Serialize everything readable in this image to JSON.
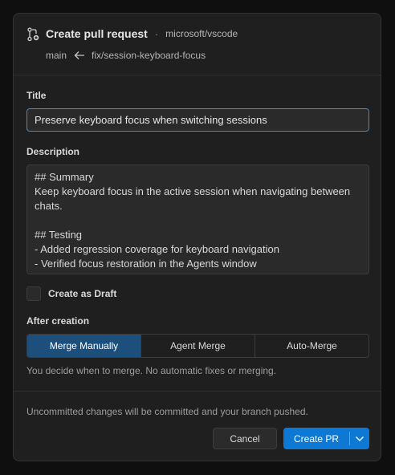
{
  "header": {
    "heading": "Create pull request",
    "separator": "·",
    "repo": "microsoft/vscode",
    "base_branch": "main",
    "head_branch": "fix/session-keyboard-focus"
  },
  "form": {
    "title_label": "Title",
    "title_value": "Preserve keyboard focus when switching sessions",
    "description_label": "Description",
    "description_value": "## Summary\nKeep keyboard focus in the active session when navigating between chats.\n\n## Testing\n- Added regression coverage for keyboard navigation\n- Verified focus restoration in the Agents window",
    "draft_label": "Create as Draft",
    "draft_checked": false,
    "after_creation_label": "After creation",
    "merge_options": [
      "Merge Manually",
      "Agent Merge",
      "Auto-Merge"
    ],
    "selected_merge_option": "Merge Manually",
    "merge_hint": "You decide when to merge. No automatic fixes or merging."
  },
  "footer": {
    "note": "Uncommitted changes will be committed and your branch pushed.",
    "cancel_label": "Cancel",
    "create_label": "Create PR"
  },
  "colors": {
    "accent": "#0e78d5",
    "focus_border": "#3a8fd8",
    "active_segment": "#1c4f7c"
  },
  "icons": {
    "header": "git-pull-request-create-icon",
    "branch_arrow": "arrow-left-icon",
    "dropdown": "chevron-down-icon"
  }
}
